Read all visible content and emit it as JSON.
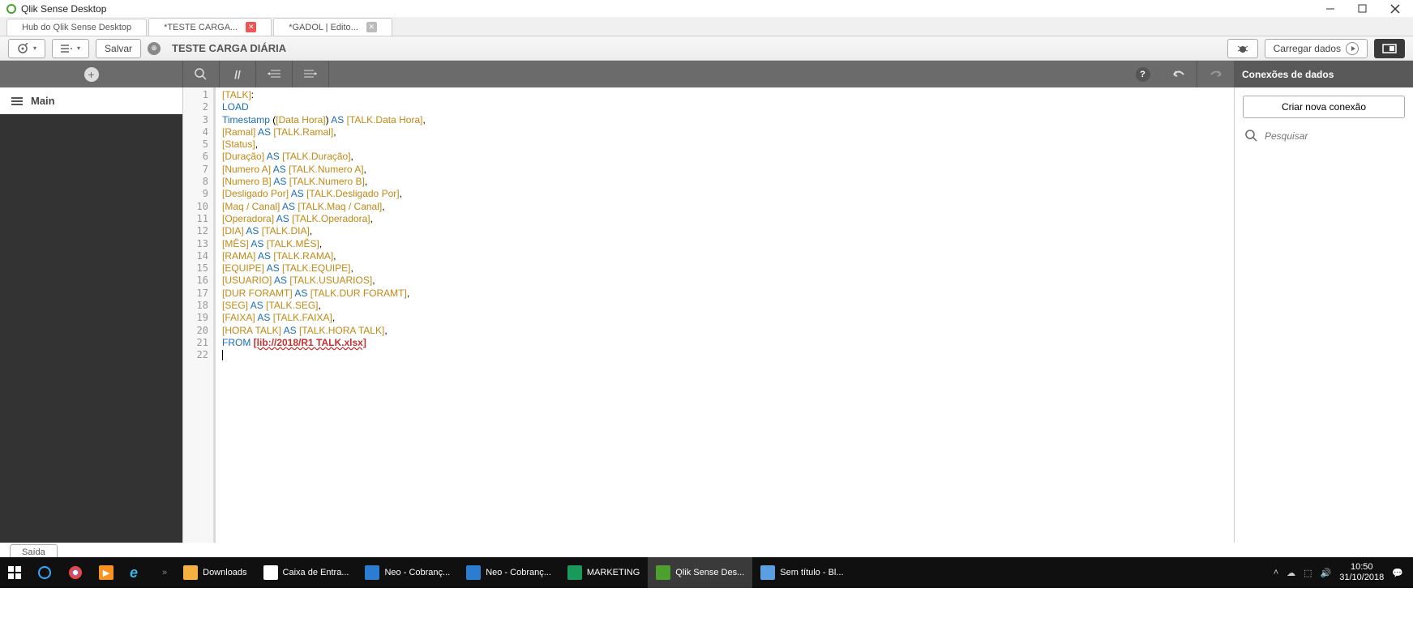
{
  "window": {
    "title": "Qlik Sense Desktop"
  },
  "tabs": [
    {
      "label": "Hub do Qlik Sense Desktop"
    },
    {
      "label": "*TESTE CARGA..."
    },
    {
      "label": "*GADOL | Edito..."
    }
  ],
  "toolbar": {
    "save": "Salvar",
    "app_title": "TESTE CARGA DIÁRIA",
    "load_data": "Carregar dados"
  },
  "sections": {
    "main": "Main"
  },
  "right": {
    "header": "Conexões de dados",
    "create": "Criar nova conexão",
    "search_placeholder": "Pesquisar"
  },
  "output": {
    "label": "Saída"
  },
  "code_lines": [
    [
      [
        "field",
        "[TALK]"
      ],
      [
        "",
        ":"
      ]
    ],
    [
      [
        "kw",
        "LOAD"
      ]
    ],
    [
      [
        "func",
        "Timestamp"
      ],
      [
        "",
        " ("
      ],
      [
        "field",
        "[Data Hora]"
      ],
      [
        "",
        ") "
      ],
      [
        "kw",
        "AS"
      ],
      [
        "",
        " "
      ],
      [
        "field",
        "[TALK.Data Hora]"
      ],
      [
        "",
        ","
      ]
    ],
    [
      [
        "field",
        "[Ramal]"
      ],
      [
        "",
        " "
      ],
      [
        "kw",
        "AS"
      ],
      [
        "",
        " "
      ],
      [
        "field",
        "[TALK.Ramal]"
      ],
      [
        "",
        ","
      ]
    ],
    [
      [
        "field",
        "[Status]"
      ],
      [
        "",
        ","
      ]
    ],
    [
      [
        "field",
        "[Duração]"
      ],
      [
        "",
        " "
      ],
      [
        "kw",
        "AS"
      ],
      [
        "",
        " "
      ],
      [
        "field",
        "[TALK.Duração]"
      ],
      [
        "",
        ","
      ]
    ],
    [
      [
        "field",
        "[Numero A]"
      ],
      [
        "",
        " "
      ],
      [
        "kw",
        "AS"
      ],
      [
        "",
        " "
      ],
      [
        "field",
        "[TALK.Numero A]"
      ],
      [
        "",
        ","
      ]
    ],
    [
      [
        "field",
        "[Numero B]"
      ],
      [
        "",
        " "
      ],
      [
        "kw",
        "AS"
      ],
      [
        "",
        " "
      ],
      [
        "field",
        "[TALK.Numero B]"
      ],
      [
        "",
        ","
      ]
    ],
    [
      [
        "field",
        "[Desligado Por]"
      ],
      [
        "",
        " "
      ],
      [
        "kw",
        "AS"
      ],
      [
        "",
        " "
      ],
      [
        "field",
        "[TALK.Desligado Por]"
      ],
      [
        "",
        ","
      ]
    ],
    [
      [
        "field",
        "[Maq / Canal]"
      ],
      [
        "",
        " "
      ],
      [
        "kw",
        "AS"
      ],
      [
        "",
        " "
      ],
      [
        "field",
        "[TALK.Maq / Canal]"
      ],
      [
        "",
        ","
      ]
    ],
    [
      [
        "field",
        "[Operadora]"
      ],
      [
        "",
        " "
      ],
      [
        "kw",
        "AS"
      ],
      [
        "",
        " "
      ],
      [
        "field",
        "[TALK.Operadora]"
      ],
      [
        "",
        ","
      ]
    ],
    [
      [
        "field",
        "[DIA]"
      ],
      [
        "",
        " "
      ],
      [
        "kw",
        "AS"
      ],
      [
        "",
        " "
      ],
      [
        "field",
        "[TALK.DIA]"
      ],
      [
        "",
        ","
      ]
    ],
    [
      [
        "field",
        "[MÊS]"
      ],
      [
        "",
        " "
      ],
      [
        "kw",
        "AS"
      ],
      [
        "",
        " "
      ],
      [
        "field",
        "[TALK.MÊS]"
      ],
      [
        "",
        ","
      ]
    ],
    [
      [
        "field",
        "[RAMA]"
      ],
      [
        "",
        " "
      ],
      [
        "kw",
        "AS"
      ],
      [
        "",
        " "
      ],
      [
        "field",
        "[TALK.RAMA]"
      ],
      [
        "",
        ","
      ]
    ],
    [
      [
        "field",
        "[EQUIPE]"
      ],
      [
        "",
        " "
      ],
      [
        "kw",
        "AS"
      ],
      [
        "",
        " "
      ],
      [
        "field",
        "[TALK.EQUIPE]"
      ],
      [
        "",
        ","
      ]
    ],
    [
      [
        "field",
        "[USUARIO]"
      ],
      [
        "",
        " "
      ],
      [
        "kw",
        "AS"
      ],
      [
        "",
        " "
      ],
      [
        "field",
        "[TALK.USUARIOS]"
      ],
      [
        "",
        ","
      ]
    ],
    [
      [
        "field",
        "[DUR FORAMT]"
      ],
      [
        "",
        " "
      ],
      [
        "kw",
        "AS"
      ],
      [
        "",
        " "
      ],
      [
        "field",
        "[TALK.DUR FORAMT]"
      ],
      [
        "",
        ","
      ]
    ],
    [
      [
        "field",
        "[SEG]"
      ],
      [
        "",
        " "
      ],
      [
        "kw",
        "AS"
      ],
      [
        "",
        " "
      ],
      [
        "field",
        "[TALK.SEG]"
      ],
      [
        "",
        ","
      ]
    ],
    [
      [
        "field",
        "[FAIXA]"
      ],
      [
        "",
        " "
      ],
      [
        "kw",
        "AS"
      ],
      [
        "",
        " "
      ],
      [
        "field",
        "[TALK.FAIXA]"
      ],
      [
        "",
        ","
      ]
    ],
    [
      [
        "field",
        "[HORA TALK]"
      ],
      [
        "",
        " "
      ],
      [
        "kw",
        "AS"
      ],
      [
        "",
        " "
      ],
      [
        "field",
        "[TALK.HORA TALK]"
      ],
      [
        "",
        ","
      ]
    ],
    [
      [
        "kw",
        "FROM"
      ],
      [
        "",
        " "
      ],
      [
        "err",
        "[lib://2018/R1 TALK.xlsx]"
      ]
    ],
    [
      [
        "",
        ""
      ]
    ]
  ],
  "taskbar": {
    "items": [
      {
        "label": "Downloads",
        "color": "#f5b041"
      },
      {
        "label": "Caixa de Entra...",
        "color": "#fff"
      },
      {
        "label": "Neo - Cobranç...",
        "color": "#2a7dd1"
      },
      {
        "label": "Neo - Cobranç...",
        "color": "#2a7dd1"
      },
      {
        "label": "MARKETING",
        "color": "#1a9a5a"
      },
      {
        "label": "Qlik Sense Des...",
        "color": "#4ca12e"
      },
      {
        "label": "Sem título - Bl...",
        "color": "#5aa0e0"
      }
    ],
    "time": "10:50",
    "date": "31/10/2018"
  }
}
